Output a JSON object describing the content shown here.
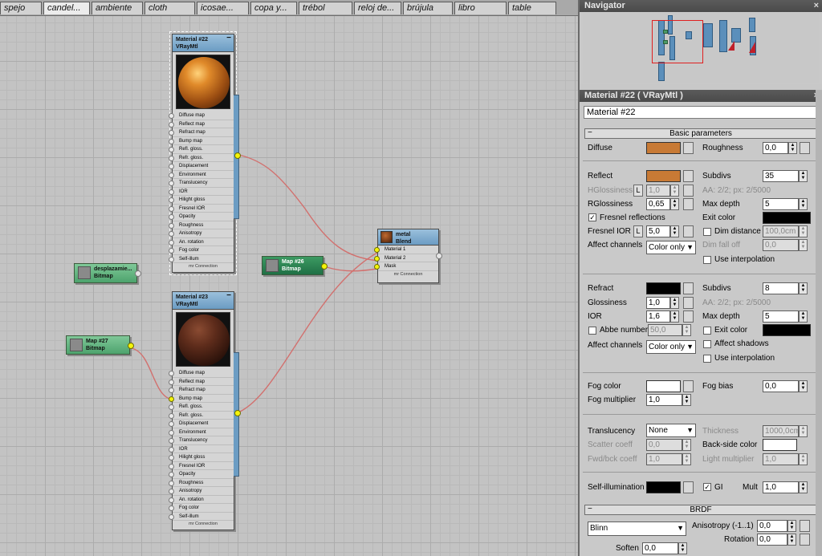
{
  "tabs": [
    "spejo",
    "candel...",
    "ambiente",
    "cloth",
    "icosae...",
    "copa y...",
    "trébol",
    "reloj de...",
    "brújula",
    "libro",
    "table"
  ],
  "nodes": {
    "m22": {
      "title": "Material #22",
      "type": "VRayMtl"
    },
    "m23": {
      "title": "Material #23",
      "type": "VRayMtl"
    },
    "blend": {
      "title": "metal",
      "type": "Blend",
      "slots": [
        "Material 1",
        "Material 2",
        "Mask"
      ],
      "foot": "mr Connection"
    },
    "map26": {
      "title": "Map #26",
      "type": "Bitmap"
    },
    "map27": {
      "title": "Map #27",
      "type": "Bitmap"
    },
    "desp": {
      "title": "desplazamie...",
      "type": "Bitmap"
    },
    "slots": [
      "Diffuse map",
      "Reflect map",
      "Refract map",
      "Bump map",
      "Refl. gloss.",
      "Refr. gloss.",
      "Displacement",
      "Environment",
      "Translucency",
      "IOR",
      "Hilight gloss",
      "Fresnel IOR",
      "Opacity",
      "Roughness",
      "Anisotropy",
      "An. rotation",
      "Fog color",
      "Self-illum"
    ],
    "foot": "mr Connection"
  },
  "navigator": {
    "title": "Navigator"
  },
  "mat": {
    "title": "Material #22  ( VRayMtl )",
    "name": "Material #22",
    "basic": "Basic parameters",
    "brdf": "BRDF",
    "diffuse": "Diffuse",
    "roughness": "Roughness",
    "roughness_v": "0,0",
    "reflect": "Reflect",
    "subdivs": "Subdivs",
    "subdivs_v": "35",
    "hgloss": "HGlossiness",
    "hgloss_v": "1,0",
    "aa1": "AA: 2/2; px: 2/5000",
    "rgloss": "RGlossiness",
    "rgloss_v": "0,65",
    "maxdepth": "Max depth",
    "maxdepth_v": "5",
    "fresnel": "Fresnel reflections",
    "exitcolor": "Exit color",
    "fior": "Fresnel IOR",
    "fior_v": "5,0",
    "dimdist": "Dim distance",
    "dimdist_v": "100,0cm",
    "affect": "Affect channels",
    "coloronly": "Color only",
    "dimfall": "Dim fall off",
    "dimfall_v": "0,0",
    "useinterp": "Use interpolation",
    "refract": "Refract",
    "rsubdivs_v": "8",
    "gloss": "Glossiness",
    "gloss_v": "1,0",
    "aa2": "AA: 2/2; px: 2/5000",
    "ior": "IOR",
    "ior_v": "1,6",
    "rmaxdepth_v": "5",
    "abbe": "Abbe number",
    "abbe_v": "50,0",
    "exitcolor2": "Exit color",
    "affectshadows": "Affect shadows",
    "useinterp2": "Use interpolation",
    "fogcolor": "Fog color",
    "fogbias": "Fog bias",
    "fogbias_v": "0,0",
    "fogmult": "Fog multiplier",
    "fogmult_v": "1,0",
    "transl": "Translucency",
    "none": "None",
    "thickness": "Thickness",
    "thickness_v": "1000,0cm",
    "scatter": "Scatter coeff",
    "scatter_v": "0,0",
    "backside": "Back-side color",
    "fwdbck": "Fwd/bck coeff",
    "fwdbck_v": "1,0",
    "lightmult": "Light multiplier",
    "lightmult_v": "1,0",
    "selfillum": "Self-illumination",
    "gi": "GI",
    "mult": "Mult",
    "mult_v": "1,0",
    "blinn": "Blinn",
    "aniso": "Anisotropy (-1..1)",
    "aniso_v": "0,0",
    "rotation": "Rotation",
    "rotation_v": "0,0",
    "soften": "Soften",
    "soften_v": "0,0",
    "colors": {
      "diffuse": "#c87a35",
      "reflect": "#c87a35",
      "refract": "#000000",
      "exit": "#000000",
      "fog": "#ffffff",
      "back": "#ffffff",
      "self": "#000000"
    }
  }
}
